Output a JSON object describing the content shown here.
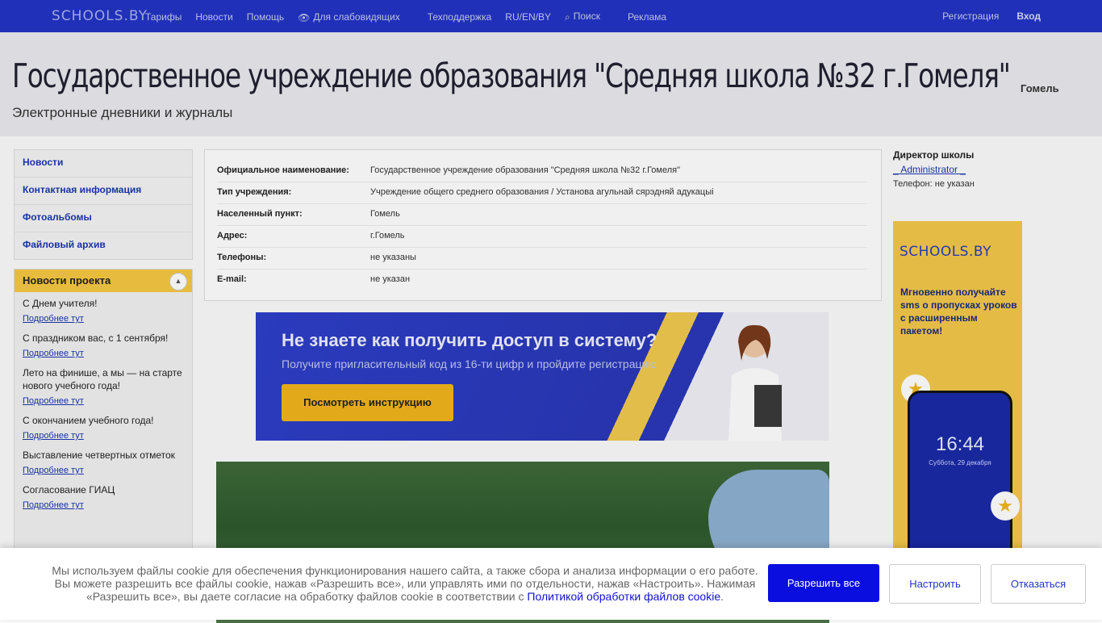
{
  "topbar": {
    "logo": "SCHOOLS.BY",
    "nav": [
      "Тарифы",
      "Новости",
      "Помощь",
      "Для слабовидящих",
      "Техподдержка",
      "RU/EN/BY",
      "Поиск",
      "Реклама"
    ],
    "register": "Регистрация",
    "login": "Вход"
  },
  "header": {
    "title": "Государственное учреждение образования \"Средняя школа №32 г.Гомеля\"",
    "city": "Гомель",
    "subtitle": "Электронные дневники и журналы"
  },
  "sidebar": {
    "items": [
      "Новости",
      "Контактная информация",
      "Фотоальбомы",
      "Файловый архив"
    ]
  },
  "news": {
    "title": "Новости проекта",
    "more_label": "Подробнее тут",
    "items": [
      "С Днем учителя!",
      "С праздником вас, с 1 сентября!",
      "Лето на финише, а мы — на старте нового учебного года!",
      "С окончанием учебного года!",
      "Выставление четвертных отметок",
      "Согласование ГИАЦ"
    ]
  },
  "info": {
    "rows": [
      {
        "k": "Официальное наименование:",
        "v": "Государственное учреждение образования \"Средняя школа №32 г.Гомеля\""
      },
      {
        "k": "Тип учреждения:",
        "v": "Учреждение общего среднего образования / Установа агульнай сярэдняй адукацыі"
      },
      {
        "k": "Населенный пункт:",
        "v": "Гомель"
      },
      {
        "k": "Адрес:",
        "v": "г.Гомель"
      },
      {
        "k": "Телефоны:",
        "v": "не указаны"
      },
      {
        "k": "E-mail:",
        "v": "не указан"
      }
    ]
  },
  "banner": {
    "headline": "Не знаете как получить доступ в систему?",
    "sub": "Получите пригласительный код из 16-ти цифр и пройдите регистрацию",
    "button": "Посмотреть инструкцию"
  },
  "director": {
    "title": "Директор школы",
    "name": "_ Administrator _",
    "phone": "Телефон: не указан"
  },
  "ad": {
    "logo": "SCHOOLS.BY",
    "text": "Мгновенно получайте sms о пропусках уроков с расширенным пакетом!",
    "time": "16:44",
    "date": "Суббота, 29 декабря"
  },
  "cookie": {
    "text": "Мы используем файлы cookie для обеспечения функционирования нашего сайта, а также сбора и анализа информации о его работе. Вы можете разрешить все файлы cookie, нажав «Разрешить все», или управлять ими по отдельности, нажав «Настроить». Нажимая «Разрешить все», вы даете согласие на обработку файлов cookie в соответствии с",
    "link": "Политикой обработки файлов cookie",
    "allow": "Разрешить все",
    "configure": "Настроить",
    "deny": "Отказаться"
  }
}
